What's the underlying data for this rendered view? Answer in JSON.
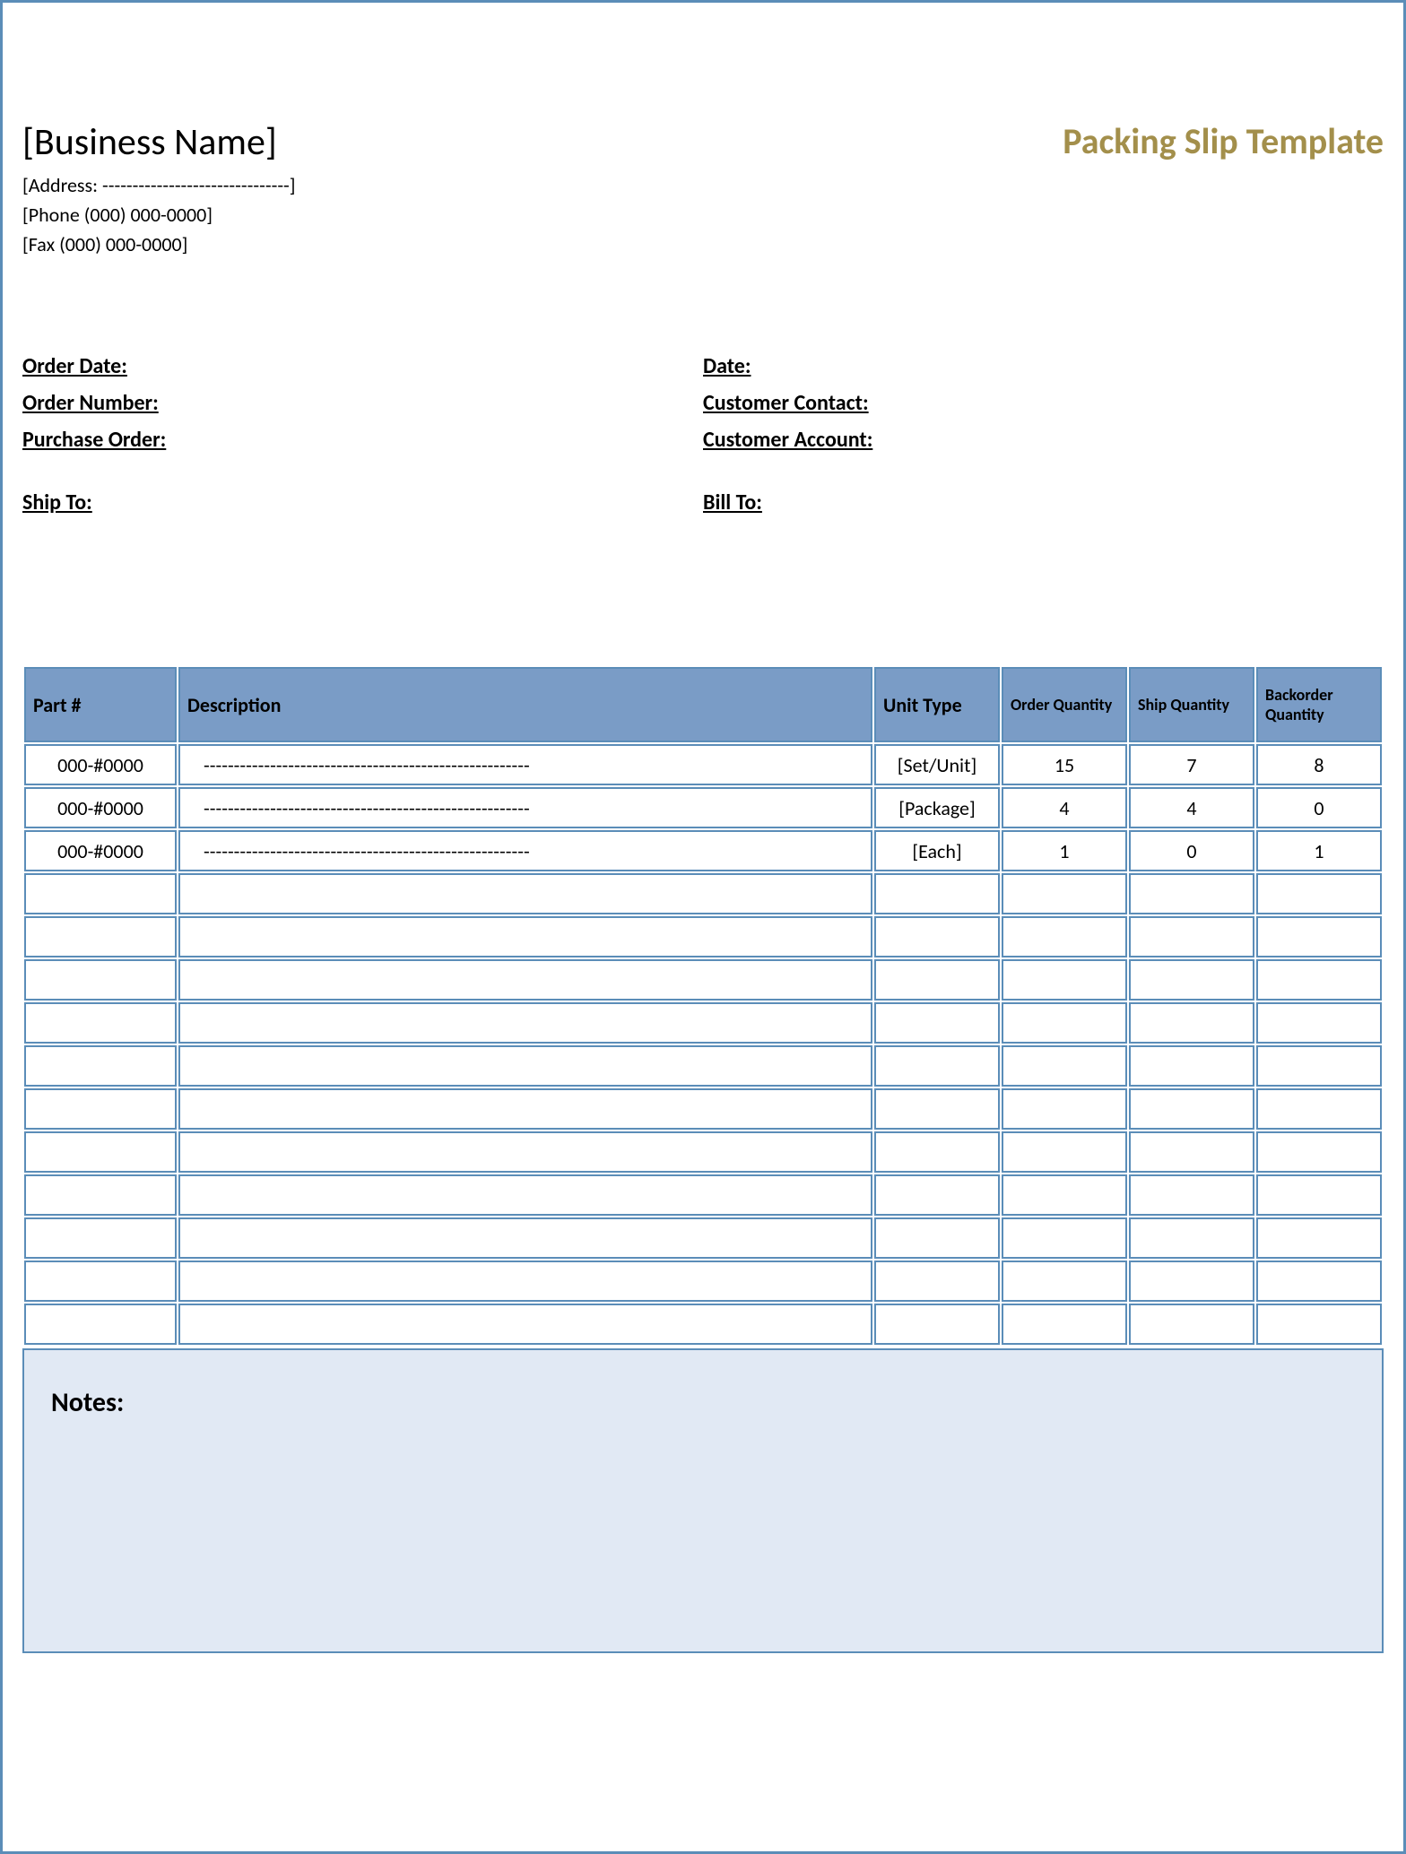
{
  "header": {
    "business_name": "[Business Name]",
    "address_line": "[Address: -------------------------------]",
    "phone_line": "[Phone (000) 000-0000]",
    "fax_line": "[Fax (000) 000-0000]",
    "doc_title": "Packing Slip Template"
  },
  "info_left": {
    "order_date": "Order Date:",
    "order_number": "Order Number:",
    "purchase_order": "Purchase Order:",
    "ship_to": "Ship To:"
  },
  "info_right": {
    "date": "Date:",
    "customer_contact": "Customer Contact:",
    "customer_account": "Customer Account:",
    "bill_to": "Bill To:"
  },
  "table": {
    "headers": {
      "part": "Part #",
      "description": "Description",
      "unit_type": "Unit Type",
      "order_qty": "Order Quantity",
      "ship_qty": "Ship Quantity",
      "backorder_qty": "Backorder Quantity"
    },
    "rows": [
      {
        "part": "000-#0000",
        "description": "------------------------------------------------------",
        "unit_type": "[Set/Unit]",
        "order_qty": "15",
        "ship_qty": "7",
        "backorder_qty": "8"
      },
      {
        "part": "000-#0000",
        "description": "------------------------------------------------------",
        "unit_type": "[Package]",
        "order_qty": "4",
        "ship_qty": "4",
        "backorder_qty": "0"
      },
      {
        "part": "000-#0000",
        "description": "------------------------------------------------------",
        "unit_type": "[Each]",
        "order_qty": "1",
        "ship_qty": "0",
        "backorder_qty": "1"
      }
    ],
    "empty_row_count": 11
  },
  "notes": {
    "label": "Notes:"
  }
}
